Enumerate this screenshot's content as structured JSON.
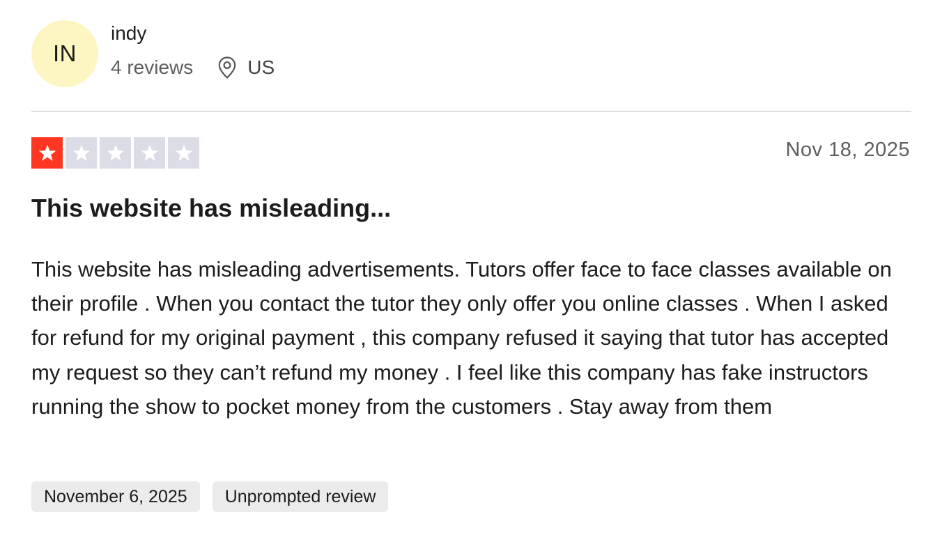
{
  "reviewer": {
    "initials": "IN",
    "avatar_color": "#fdf6c2",
    "name": "indy",
    "review_count": "4 reviews",
    "location_icon": "location-pin-icon",
    "location": "US"
  },
  "review": {
    "rating": 1,
    "rating_max": 5,
    "star_filled_color": "#ff3722",
    "star_empty_color": "#dcdce6",
    "date": "Nov 18, 2025",
    "title": "This website has misleading...",
    "body": "This website has misleading advertisements. Tutors offer face to face classes available on their profile . When you contact the tutor they only offer you online classes . When I asked for refund for my original payment , this company refused it saying that tutor has accepted my request so they can’t refund my money . I feel like this company has fake instructors running the show to pocket money from the customers . Stay away from them"
  },
  "tags": {
    "experience_date": "November 6, 2025",
    "review_type": "Unprompted review"
  }
}
